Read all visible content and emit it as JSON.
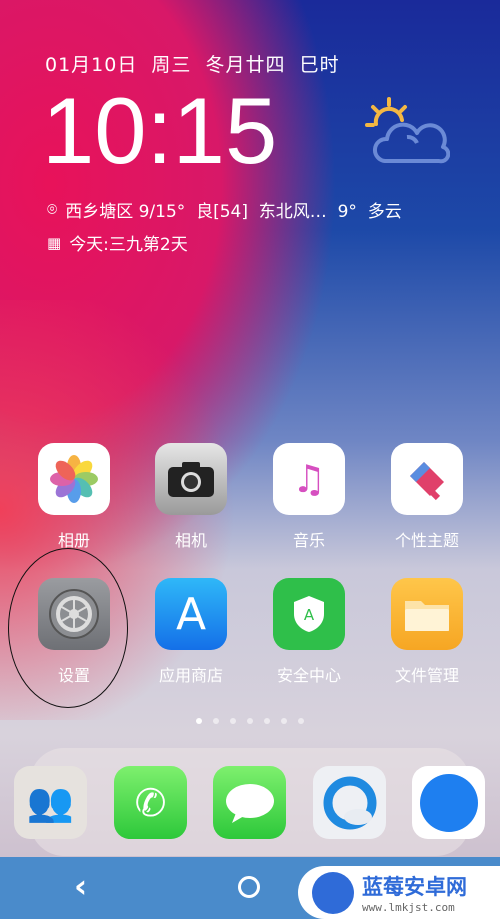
{
  "widget": {
    "date": "01月10日  周三  冬月廿四  巳时",
    "time": "10:15",
    "location": "西乡塘区 9/15°  良[54]  东北风…  9°  多云",
    "almanac": "今天:三九第2天",
    "weather_icon": "partly-cloudy-icon"
  },
  "apps": [
    {
      "label": "相册",
      "icon": "photos-icon"
    },
    {
      "label": "相机",
      "icon": "camera-icon"
    },
    {
      "label": "音乐",
      "icon": "music-icon"
    },
    {
      "label": "个性主题",
      "icon": "theme-icon"
    },
    {
      "label": "设置",
      "icon": "settings-icon"
    },
    {
      "label": "应用商店",
      "icon": "app-store-icon"
    },
    {
      "label": "安全中心",
      "icon": "security-icon"
    },
    {
      "label": "文件管理",
      "icon": "files-icon"
    }
  ],
  "page_indicator": {
    "count": 7,
    "current": 1
  },
  "dock": [
    "contacts-icon",
    "phone-icon",
    "messages-icon",
    "qq-browser-icon",
    "safari-icon"
  ],
  "watermark": {
    "title": "蓝莓安卓网",
    "url": "www.lmkjst.com"
  },
  "nav": {
    "back": "‹",
    "home": "○"
  }
}
